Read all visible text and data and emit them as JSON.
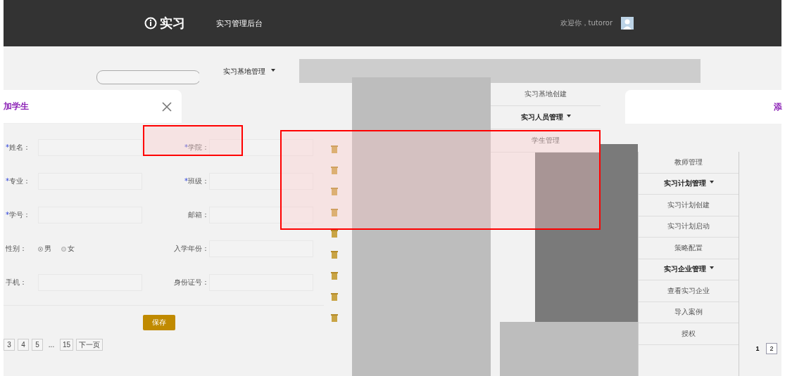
{
  "header": {
    "logo": "实习",
    "title": "实习管理后台",
    "welcome": "欢迎你，tutoror"
  },
  "nav_tab": {
    "label": "实习基地管理"
  },
  "dialog_left": {
    "title": "加学生",
    "fields": [
      {
        "kind": "text",
        "required": "*",
        "label": "姓名："
      },
      {
        "kind": "text",
        "required": "*",
        "label": "学院："
      },
      {
        "kind": "text",
        "required": "*",
        "label": "专业："
      },
      {
        "kind": "text",
        "required": "*",
        "label": "班级："
      },
      {
        "kind": "text",
        "required": "*",
        "label": "学号："
      },
      {
        "kind": "text",
        "label": "邮箱："
      },
      {
        "kind": "radio",
        "label": "性别：",
        "options": [
          {
            "label": "男",
            "selected": true
          },
          {
            "label": "女",
            "selected": false
          }
        ]
      },
      {
        "kind": "text",
        "label": "入学年份："
      },
      {
        "kind": "text",
        "label": "手机："
      },
      {
        "kind": "text",
        "label": "身份证号："
      }
    ],
    "save": "保存",
    "pagination": [
      {
        "kind": "page",
        "label": "3"
      },
      {
        "kind": "page",
        "label": "4"
      },
      {
        "kind": "page",
        "label": "5"
      },
      {
        "kind": "gap",
        "label": "..."
      },
      {
        "kind": "page",
        "label": "15"
      },
      {
        "kind": "page",
        "label": "下一页"
      }
    ]
  },
  "row_actions": [
    {
      "kind": "delete"
    },
    {
      "kind": "delete"
    },
    {
      "kind": "delete"
    },
    {
      "kind": "delete"
    },
    {
      "kind": "delete"
    },
    {
      "kind": "delete"
    },
    {
      "kind": "delete"
    },
    {
      "kind": "delete"
    },
    {
      "kind": "delete"
    }
  ],
  "menu_upper": [
    {
      "kind": "item",
      "label": "实习基地创建"
    },
    {
      "kind": "group",
      "label": "实习人员管理"
    },
    {
      "kind": "item",
      "label": "学生管理"
    }
  ],
  "menu_lower": [
    {
      "kind": "item",
      "label": "教师管理"
    },
    {
      "kind": "group",
      "label": "实习计划管理"
    },
    {
      "kind": "item",
      "label": "实习计划创建"
    },
    {
      "kind": "item",
      "label": "实习计划启动"
    },
    {
      "kind": "item",
      "label": "策略配置"
    },
    {
      "kind": "group",
      "label": "实习企业管理"
    },
    {
      "kind": "item",
      "label": "查看实习企业"
    },
    {
      "kind": "item",
      "label": "导入案例"
    },
    {
      "kind": "item",
      "label": "授权"
    }
  ],
  "dialog_right": {
    "title": "添"
  },
  "pagination_right": [
    {
      "label": "1",
      "selected": true
    },
    {
      "label": "2",
      "selected": false
    }
  ]
}
